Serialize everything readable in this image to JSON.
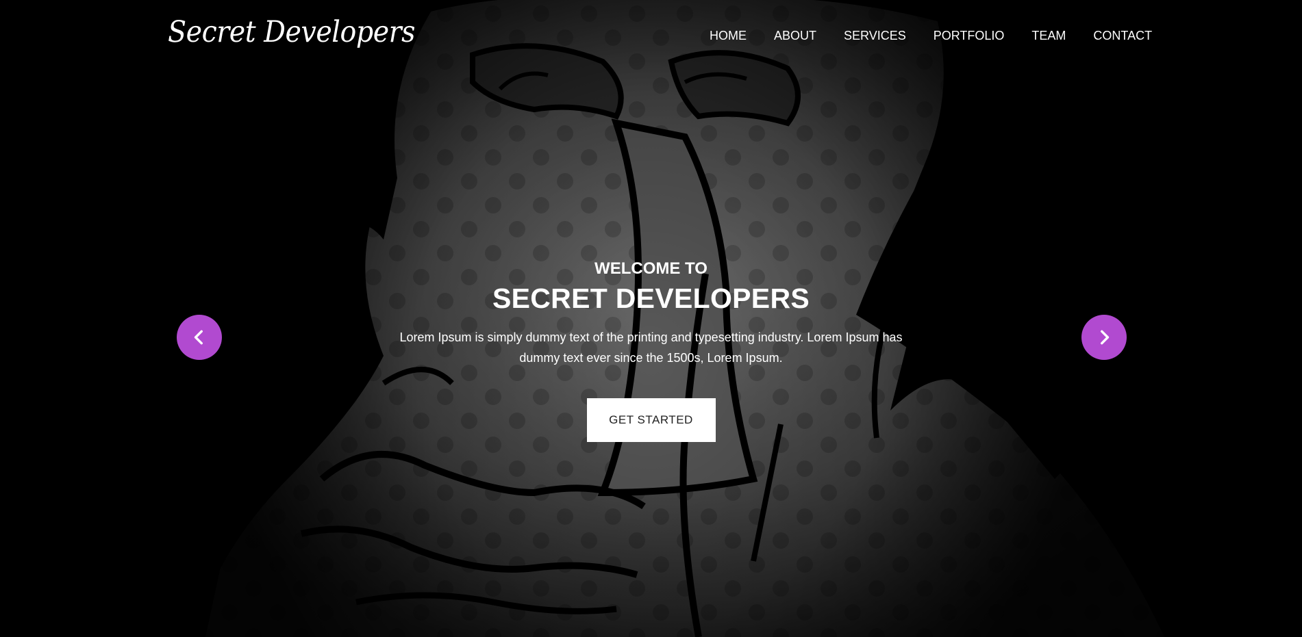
{
  "brand": {
    "logo_text": "Secret Developers"
  },
  "nav": {
    "items": [
      {
        "label": "HOME"
      },
      {
        "label": "ABOUT"
      },
      {
        "label": "SERVICES"
      },
      {
        "label": "PORTFOLIO"
      },
      {
        "label": "TEAM"
      },
      {
        "label": "CONTACT"
      }
    ]
  },
  "hero": {
    "eyebrow": "WELCOME TO",
    "title": "SECRET DEVELOPERS",
    "description": "Lorem Ipsum is simply dummy text of the printing and typesetting industry. Lorem Ipsum has dummy text ever since the 1500s, Lorem Ipsum.",
    "cta_label": "GET STARTED"
  },
  "slider": {
    "prev_icon": "chevron-left-icon",
    "next_icon": "chevron-right-icon"
  },
  "colors": {
    "accent": "#b14ad0",
    "text": "#ffffff",
    "cta_bg": "#ffffff",
    "cta_text": "#222222"
  }
}
